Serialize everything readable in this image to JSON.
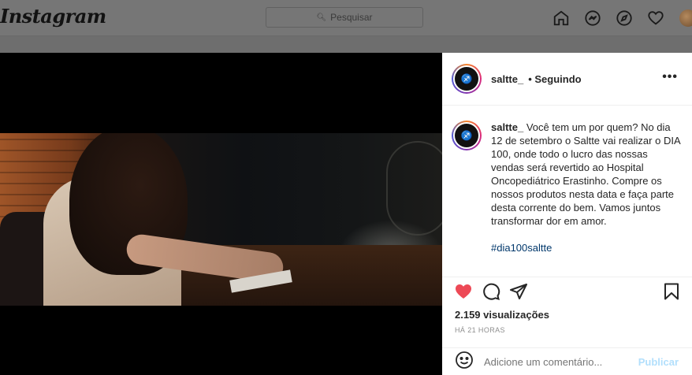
{
  "topbar": {
    "logo": "Instagram",
    "search_placeholder": "Pesquisar",
    "icons": [
      "home-icon",
      "messenger-icon",
      "explore-icon",
      "heart-icon",
      "profile-avatar"
    ]
  },
  "post": {
    "username": "saltte_",
    "following": "• Seguindo",
    "more": "•••",
    "caption_user": "saltte_",
    "caption_text": "Você tem um por quem? No dia 12 de setembro o Saltte vai realizar o DIA 100, onde todo o lucro das nossas vendas será revertido ao Hospital Oncopediátrico Erastinho. Compre os nossos produtos nesta data e faça parte desta corrente do bem. Vamos juntos transformar dor em amor.",
    "hashtag": "#dia100saltte",
    "views": "2.159 visualizações",
    "time": "HÁ 21 HORAS",
    "liked": true
  },
  "comment": {
    "placeholder": "Adicione um comentário...",
    "publish": "Publicar"
  },
  "colors": {
    "like_red": "#ed4956",
    "link_blue": "#00376b",
    "publish_disabled": "#b2dffc"
  }
}
